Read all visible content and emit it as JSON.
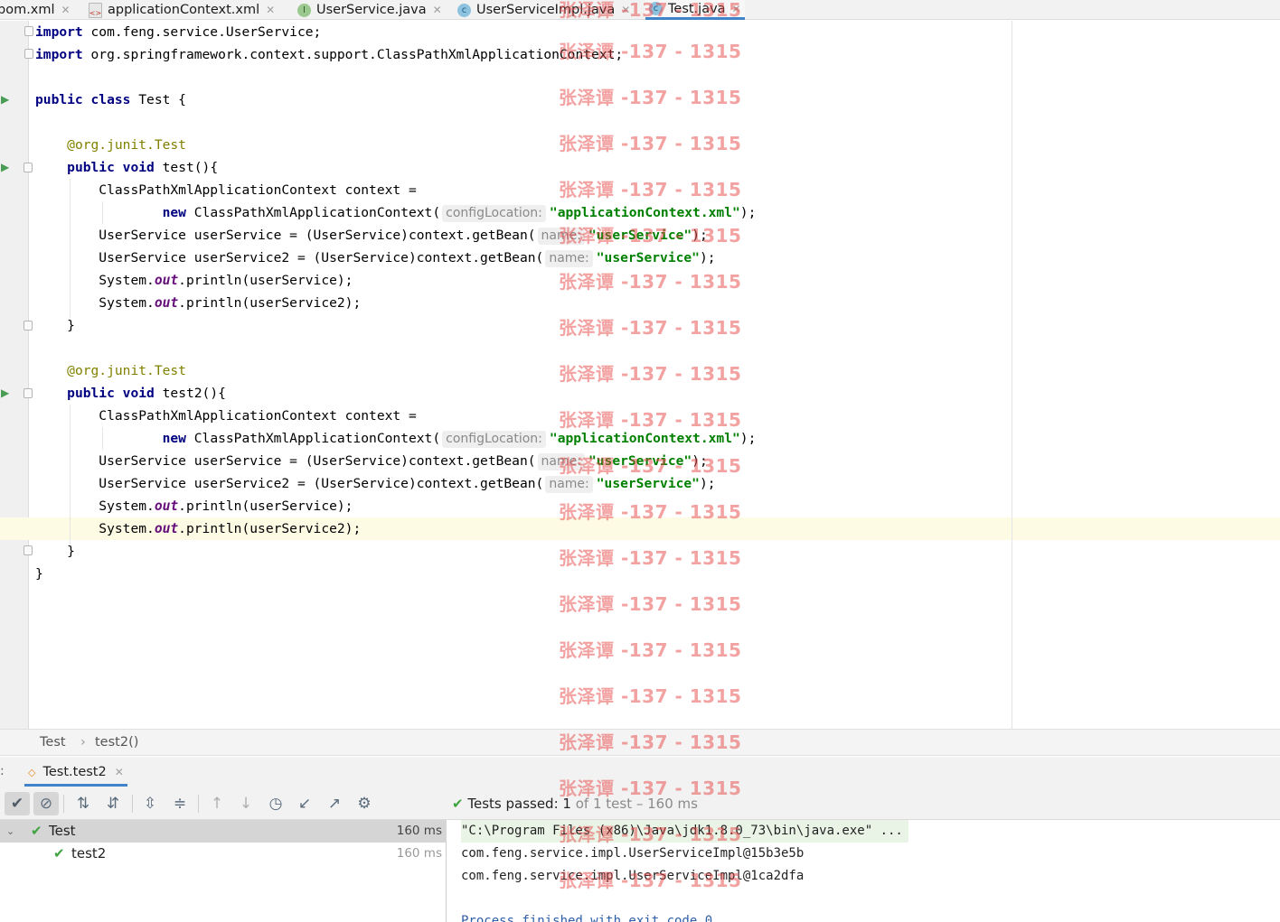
{
  "tabs": [
    {
      "label": "pom.xml",
      "icon": "maven-file-icon",
      "active": false
    },
    {
      "label": "applicationContext.xml",
      "icon": "xml-file-icon",
      "active": false
    },
    {
      "label": "UserService.java",
      "icon": "interface-file-icon",
      "active": false
    },
    {
      "label": "UserServiceImpl.java",
      "icon": "class-file-icon",
      "active": false
    },
    {
      "label": "Test.java",
      "icon": "class-file-icon",
      "active": true
    }
  ],
  "code": {
    "import1": "com.feng.service.UserService;",
    "import2": "org.springframework.context.support.ClassPathXmlApplicationContext;",
    "kw_import": "import",
    "class_decl": "Test {",
    "kw_public": "public",
    "kw_class": "class",
    "kw_void": "void",
    "kw_new": "new",
    "annotation_prefix": "@org.junit.",
    "annotation_name": "Test",
    "method1": "test(){",
    "method2": "test2(){",
    "ctx_decl": "ClassPathXmlApplicationContext context =",
    "ctx_ctor": "ClassPathXmlApplicationContext(",
    "hint_config": "configLocation:",
    "xml_string": "\"applicationContext.xml\"",
    "close_paren": ");",
    "us1_decl": "UserService userService = (UserService)context.getBean(",
    "us2_decl": "UserService userService2 = (UserService)context.getBean(",
    "hint_name": "name:",
    "bean_string": "\"userService\"",
    "sys": "System.",
    "out": "out",
    "println1": ".println(userService);",
    "println2": ".println(userService2);",
    "close_brace": "}"
  },
  "breadcrumb": {
    "class": "Test",
    "separator": "›",
    "method": "test2()"
  },
  "run": {
    "tab_label": "Test.test2",
    "status_main": "Tests passed:",
    "status_count": "1",
    "status_rest": "of 1 test – 160 ms"
  },
  "tree": [
    {
      "label": "Test",
      "duration": "160 ms"
    },
    {
      "label": "test2",
      "duration": "160 ms"
    }
  ],
  "console": [
    "\"C:\\Program Files (x86)\\Java\\jdk1.8.0_73\\bin\\java.exe\" ...",
    "com.feng.service.impl.UserServiceImpl@15b3e5b",
    "com.feng.service.impl.UserServiceImpl@1ca2dfa",
    "",
    "Process finished with exit code 0"
  ],
  "watermark": "张泽谭 -137 - 1315",
  "colors": {
    "keyword": "#000080",
    "string": "#008000",
    "annotation": "#808000",
    "static_field": "#660e7a",
    "pass": "#3fa33f",
    "watermark": "#e84646",
    "accent": "#4083c9"
  }
}
